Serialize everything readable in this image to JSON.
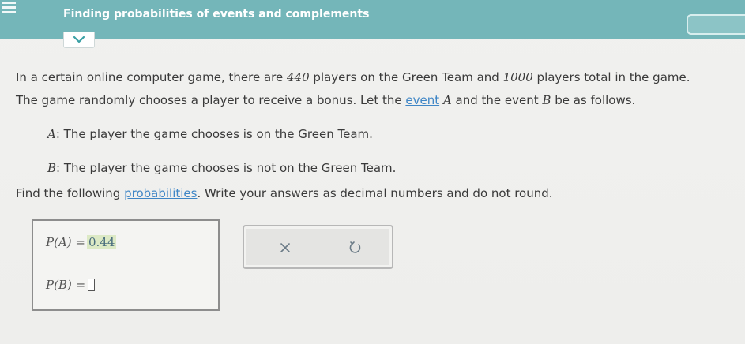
{
  "header": {
    "title": "Finding probabilities of events and complements"
  },
  "question": {
    "line1": {
      "prefix": "In a certain online computer game, there are ",
      "green_count": "440",
      "middle": " players on the Green Team and ",
      "total_count": "1000",
      "suffix": " players total in the game."
    },
    "line2": {
      "prefix": "The game randomly chooses a player to receive a bonus. Let the ",
      "event_link": "event",
      "var_a": "A",
      "middle": " and the event ",
      "var_b": "B",
      "suffix": " be as follows."
    },
    "event_a": {
      "label": "A",
      "text": ": The player the game chooses is on the Green Team."
    },
    "event_b": {
      "label": "B",
      "text": ": The player the game chooses is not on the Green Team."
    },
    "instruction": {
      "prefix": "Find the following ",
      "link": "probabilities",
      "suffix": ". Write your answers as decimal numbers and do not round."
    }
  },
  "answers": {
    "pa": {
      "label": "P(A) =",
      "value": "0.44"
    },
    "pb": {
      "label": "P(B) =",
      "value": ""
    }
  },
  "actions": {
    "clear_icon": "close-icon",
    "undo_icon": "undo-icon"
  },
  "colors": {
    "header": "#74b6b9",
    "link": "#3f86c6",
    "answer_highlight": "#dce9c5"
  }
}
